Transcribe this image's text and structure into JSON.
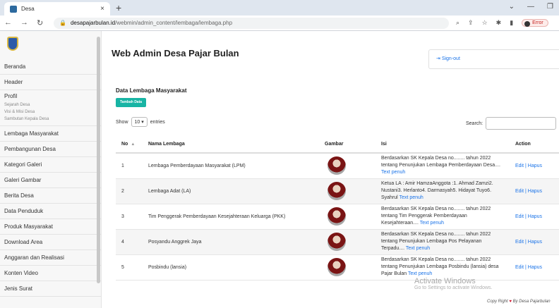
{
  "browser": {
    "tab_title": "Desa",
    "tab_close": "×",
    "new_tab": "+",
    "url_host": "desapajarbulan.id",
    "url_path": "/webmin/admin_content/lembaga/lembaga.php",
    "error_label": "Error",
    "win_min": "—",
    "win_chevron": "⌄",
    "win_max": "❐"
  },
  "sidebar": {
    "items_top": [
      "Beranda",
      "Header"
    ],
    "profil": {
      "title": "Profil",
      "subs": [
        "Sejarah Desa",
        "Visi & Misi Desa",
        "Sambutan Kepala Desa"
      ]
    },
    "items": [
      "Lembaga Masyarakat",
      "Pembangunan Desa",
      "Kategori Galeri",
      "Galeri Gambar",
      "Berita Desa",
      "Data Penduduk",
      "Produk Masyarakat",
      "Download Area",
      "Anggaran dan Realisasi",
      "Konten Video",
      "Jenis Surat"
    ]
  },
  "main": {
    "page_title": "Web Admin Desa Pajar Bulan",
    "signout": "Sign-out",
    "section_title": "Data Lembaga Masyarakat",
    "add_button": "Tambah Data",
    "show_label": "Show",
    "show_value": "10",
    "entries_label": "entries",
    "search_label": "Search:",
    "headers": [
      "No",
      "Nama Lembaga",
      "Gambar",
      "Isi",
      "Action"
    ],
    "rows": [
      {
        "no": "1",
        "nama": "Lembaga Pemberdayaan Masyarakat (LPM)",
        "isi": "Berdasarkan SK Kepala Desa no........ tahun 2022 tentang Penunjukan Lembaga Pemberdayaan Desa....",
        "link": "Text penuh",
        "action": "Edit | Hapus"
      },
      {
        "no": "2",
        "nama": "Lembaga Adat (LA)",
        "isi": "Ketua LA : Amir HamzaAnggota :1. Ahmad Zamzi2. Nustani3. Herlanto4. Darmasyah5. Hidayat Tuyo6. Syahrul",
        "link": "Text penuh",
        "action": "Edit | Hapus"
      },
      {
        "no": "3",
        "nama": "Tim Penggerak Pemberdayaan Kesejahteraan Keluarga (PKK)",
        "isi": "Berdasarkan SK Kepala Desa no........ tahun 2022 tentang Tim Penggerak Pemberdayaan Kesejahteraan....",
        "link": "Text penuh",
        "action": "Edit | Hapus"
      },
      {
        "no": "4",
        "nama": "Posyandu Anggrek Jaya",
        "isi": "Berdasarkan SK Kepala Desa no........ tahun 2022 tentang Penunjukan Lembaga Pos Pelayanan Terpadu....",
        "link": "Text penuh",
        "action": "Edit | Hapus"
      },
      {
        "no": "5",
        "nama": "Posbindu (lansia)",
        "isi": "Berdasarkan SK Kepala Desa no........ tahun 2022 tentang Penunjukan Lembaga Posbindu (lansia) desa Pajar Bulan",
        "link": "Text penuh",
        "action": "Edit | Hapus"
      }
    ]
  },
  "overlay": {
    "watermark": "Activate Windows",
    "watermark_sub": "Go to Settings to activate Windows.",
    "copyright_pre": "Copy Right",
    "copyright_heart": "♥",
    "copyright_post": "By Desa Pajarbulan"
  }
}
